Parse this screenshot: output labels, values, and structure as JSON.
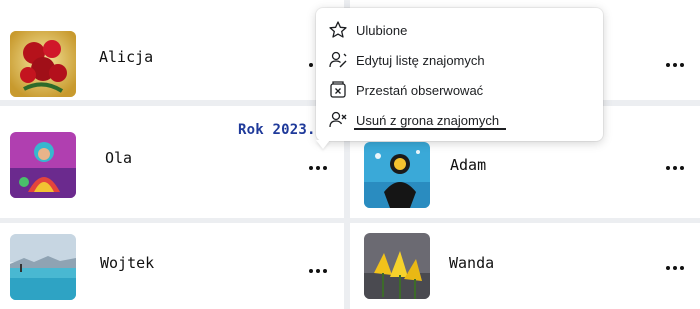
{
  "friends": [
    {
      "name": "Alicja",
      "avatar": "red-roses-photo",
      "menu_icon": "more-options-icon"
    },
    {
      "name": "Ola",
      "avatar": "colorful-figure-photo",
      "menu_icon": "more-options-icon"
    },
    {
      "name": "Wojtek",
      "avatar": "lake-landscape-photo",
      "menu_icon": "more-options-icon"
    },
    {
      "name": "Adam",
      "avatar": "diver-photo",
      "menu_icon": "more-options-icon"
    },
    {
      "name": "Wanda",
      "avatar": "yellow-flowers-photo",
      "menu_icon": "more-options-icon"
    }
  ],
  "annotation": "Rok 2023......",
  "context_menu": {
    "items": [
      {
        "label": "Ulubione",
        "icon": "star-icon"
      },
      {
        "label": "Edytuj listę znajomych",
        "icon": "edit-friend-list-icon"
      },
      {
        "label": "Przestań obserwować",
        "icon": "unfollow-icon"
      },
      {
        "label": "Usuń z grona znajomych",
        "icon": "remove-friend-icon"
      }
    ]
  },
  "colors": {
    "annotation_text": "#1f3a9a",
    "card_background": "#ffffff",
    "page_background": "#eceef1"
  }
}
